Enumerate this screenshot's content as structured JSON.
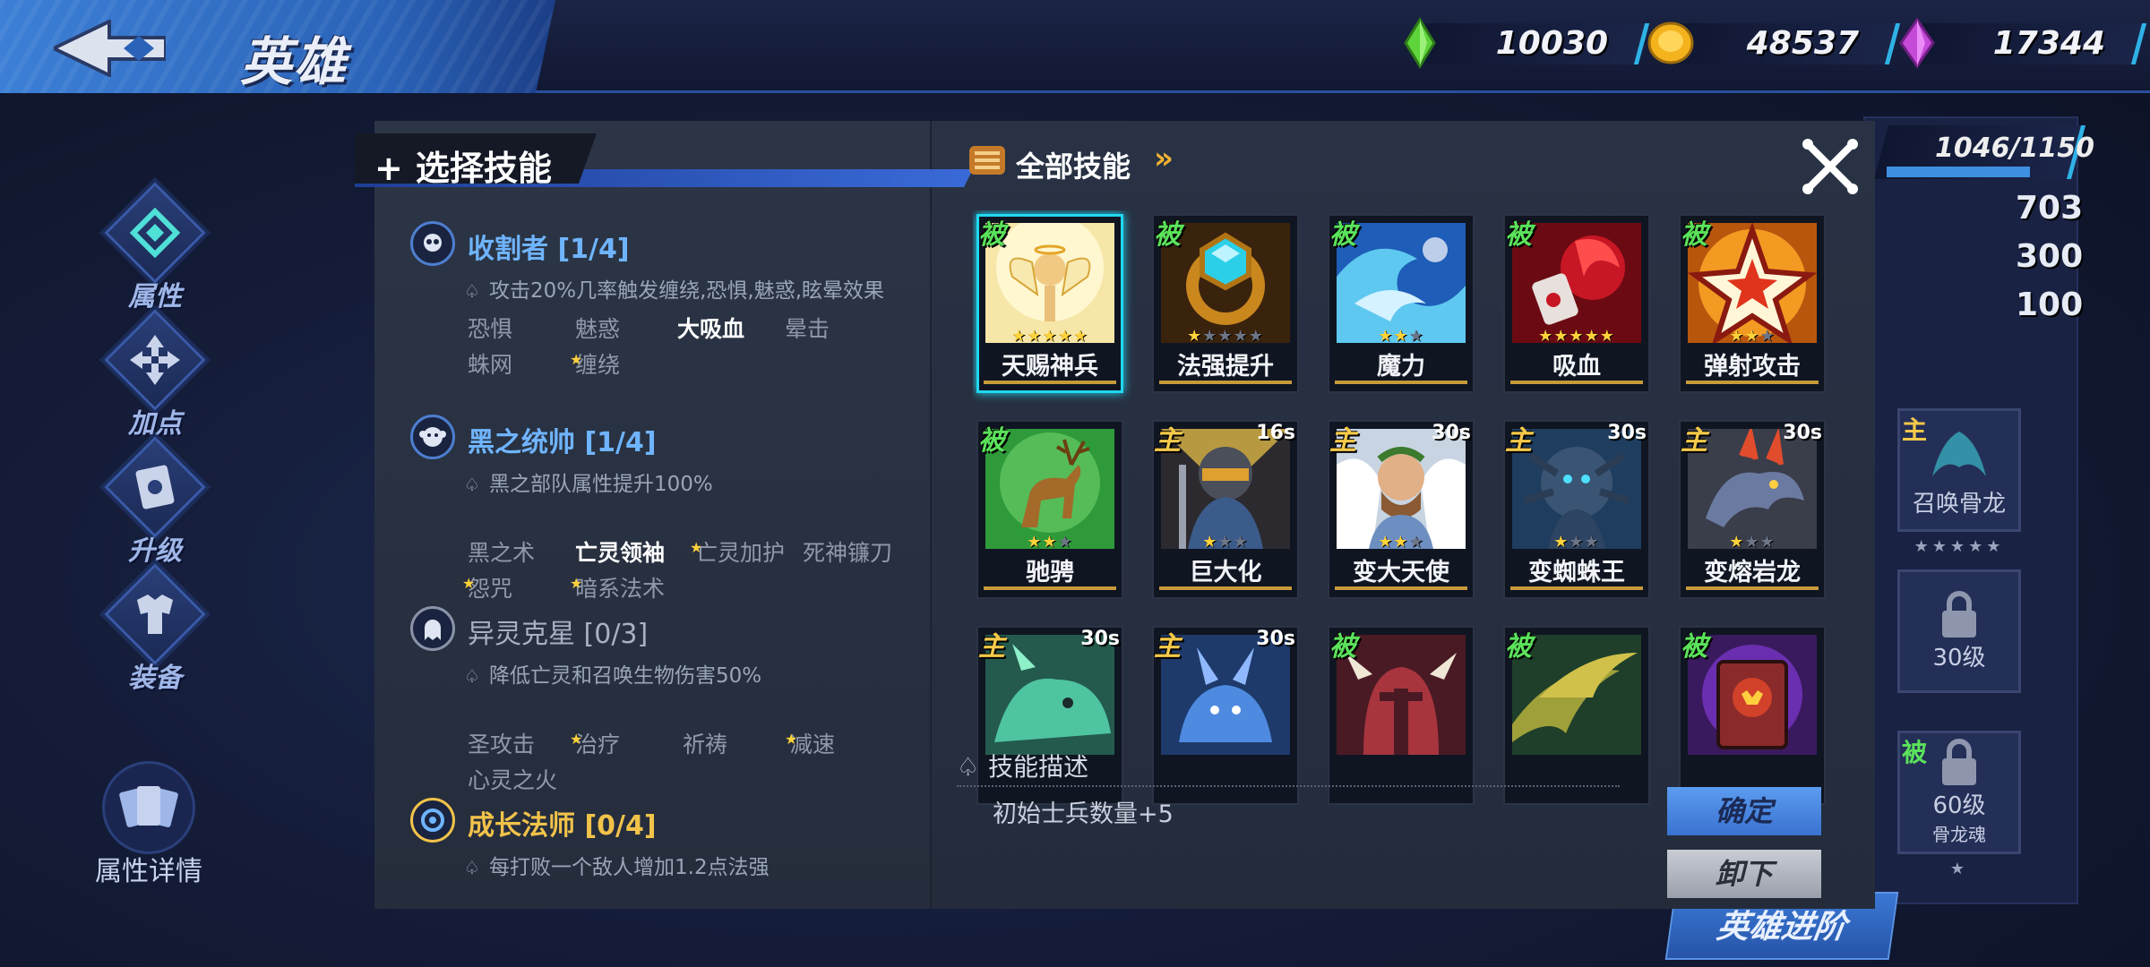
{
  "header": {
    "title": "英雄"
  },
  "currencies": [
    {
      "name": "green-gem",
      "value": "10030",
      "color": "#5fd33a"
    },
    {
      "name": "gold-coin",
      "value": "48537",
      "color": "#f4b21d"
    },
    {
      "name": "purple-gem",
      "value": "17344",
      "color": "#c54ad8"
    }
  ],
  "nav": {
    "attributes": "属性",
    "points": "加点",
    "upgrade": "升级",
    "equipment": "装备",
    "attribute_details": "属性详情"
  },
  "background": {
    "hp": "1046/1150",
    "stats": [
      "703",
      "300",
      "100"
    ],
    "slots": [
      {
        "tag": "主",
        "label": "召唤骨龙",
        "stars": 5,
        "lit": 0
      },
      {
        "tag": "",
        "label": "30级",
        "locked": true
      },
      {
        "tag": "被",
        "label": "60级",
        "sub": "骨龙魂",
        "locked": true,
        "stars": 1,
        "lit": 0
      }
    ],
    "advance_button": "英雄进阶"
  },
  "dialog": {
    "title": "选择技能",
    "groups": [
      {
        "name": "收割者 [1/4]",
        "style": "active",
        "desc": "攻击20%几率触发缠绕,恐惧,魅惑,眩晕效果",
        "tags": [
          {
            "label": "恐惧",
            "on": false,
            "star": false
          },
          {
            "label": "魅惑",
            "on": false,
            "star": false
          },
          {
            "label": "大吸血",
            "on": true,
            "star": false
          },
          {
            "label": "晕击",
            "on": false,
            "star": false
          },
          {
            "label": "蛛网",
            "on": false,
            "star": false
          },
          {
            "label": "缠绕",
            "on": false,
            "star": true
          }
        ]
      },
      {
        "name": "黑之统帅 [1/4]",
        "style": "active",
        "desc": "黑之部队属性提升100%",
        "tags": [
          {
            "label": "黑之术",
            "on": false,
            "star": false
          },
          {
            "label": "亡灵领袖",
            "on": true,
            "star": false
          },
          {
            "label": "亡灵加护",
            "on": false,
            "star": true
          },
          {
            "label": "死神镰刀",
            "on": false,
            "star": false
          },
          {
            "label": "怨咒",
            "on": false,
            "star": true
          },
          {
            "label": "暗系法术",
            "on": false,
            "star": true
          }
        ]
      },
      {
        "name": "异灵克星 [0/3]",
        "style": "dim",
        "desc": "降低亡灵和召唤生物伤害50%",
        "tags": [
          {
            "label": "圣攻击",
            "on": false,
            "star": false
          },
          {
            "label": "治疗",
            "on": false,
            "star": true
          },
          {
            "label": "祈祷",
            "on": false,
            "star": false
          },
          {
            "label": "减速",
            "on": false,
            "star": true
          },
          {
            "label": "心灵之火",
            "on": false,
            "star": false
          }
        ]
      },
      {
        "name": "成长法师 [0/4]",
        "style": "gold",
        "desc": "每打败一个敌人增加1.2点法强",
        "tags": []
      }
    ],
    "all_skills_label": "全部技能",
    "skills": [
      {
        "name": "天赐神兵",
        "type": "被",
        "kind": "passive",
        "cd": "",
        "stars": 5,
        "lit": 5,
        "art": "angel",
        "selected": true
      },
      {
        "name": "法强提升",
        "type": "被",
        "kind": "passive",
        "cd": "",
        "stars": 5,
        "lit": 1,
        "art": "ring"
      },
      {
        "name": "魔力",
        "type": "被",
        "kind": "passive",
        "cd": "",
        "stars": 3,
        "lit": 2,
        "art": "wave"
      },
      {
        "name": "吸血",
        "type": "被",
        "kind": "passive",
        "cd": "",
        "stars": 5,
        "lit": 5,
        "art": "blood"
      },
      {
        "name": "弹射攻击",
        "type": "被",
        "kind": "passive",
        "cd": "",
        "stars": 3,
        "lit": 2,
        "art": "star"
      },
      {
        "name": "驰骋",
        "type": "被",
        "kind": "passive",
        "cd": "",
        "stars": 3,
        "lit": 2,
        "art": "deer"
      },
      {
        "name": "巨大化",
        "type": "主",
        "kind": "active",
        "cd": "16s",
        "stars": 3,
        "lit": 1,
        "art": "giant"
      },
      {
        "name": "变大天使",
        "type": "主",
        "kind": "active",
        "cd": "30s",
        "stars": 3,
        "lit": 2,
        "art": "archangel"
      },
      {
        "name": "变蜘蛛王",
        "type": "主",
        "kind": "active",
        "cd": "30s",
        "stars": 3,
        "lit": 1,
        "art": "spider"
      },
      {
        "name": "变熔岩龙",
        "type": "主",
        "kind": "active",
        "cd": "30s",
        "stars": 3,
        "lit": 1,
        "art": "dragon"
      },
      {
        "name": "",
        "type": "主",
        "kind": "active",
        "cd": "30s",
        "stars": 0,
        "lit": 0,
        "art": "greendragon"
      },
      {
        "name": "",
        "type": "主",
        "kind": "active",
        "cd": "30s",
        "stars": 0,
        "lit": 0,
        "art": "bluedragon"
      },
      {
        "name": "",
        "type": "被",
        "kind": "passive",
        "cd": "",
        "stars": 0,
        "lit": 0,
        "art": "helmet"
      },
      {
        "name": "",
        "type": "被",
        "kind": "passive",
        "cd": "",
        "stars": 0,
        "lit": 0,
        "art": "vine"
      },
      {
        "name": "",
        "type": "被",
        "kind": "passive",
        "cd": "",
        "stars": 0,
        "lit": 0,
        "art": "book"
      }
    ],
    "description_label": "技能描述",
    "description_text": "初始士兵数量+5",
    "confirm": "确定",
    "unequip": "卸下"
  }
}
